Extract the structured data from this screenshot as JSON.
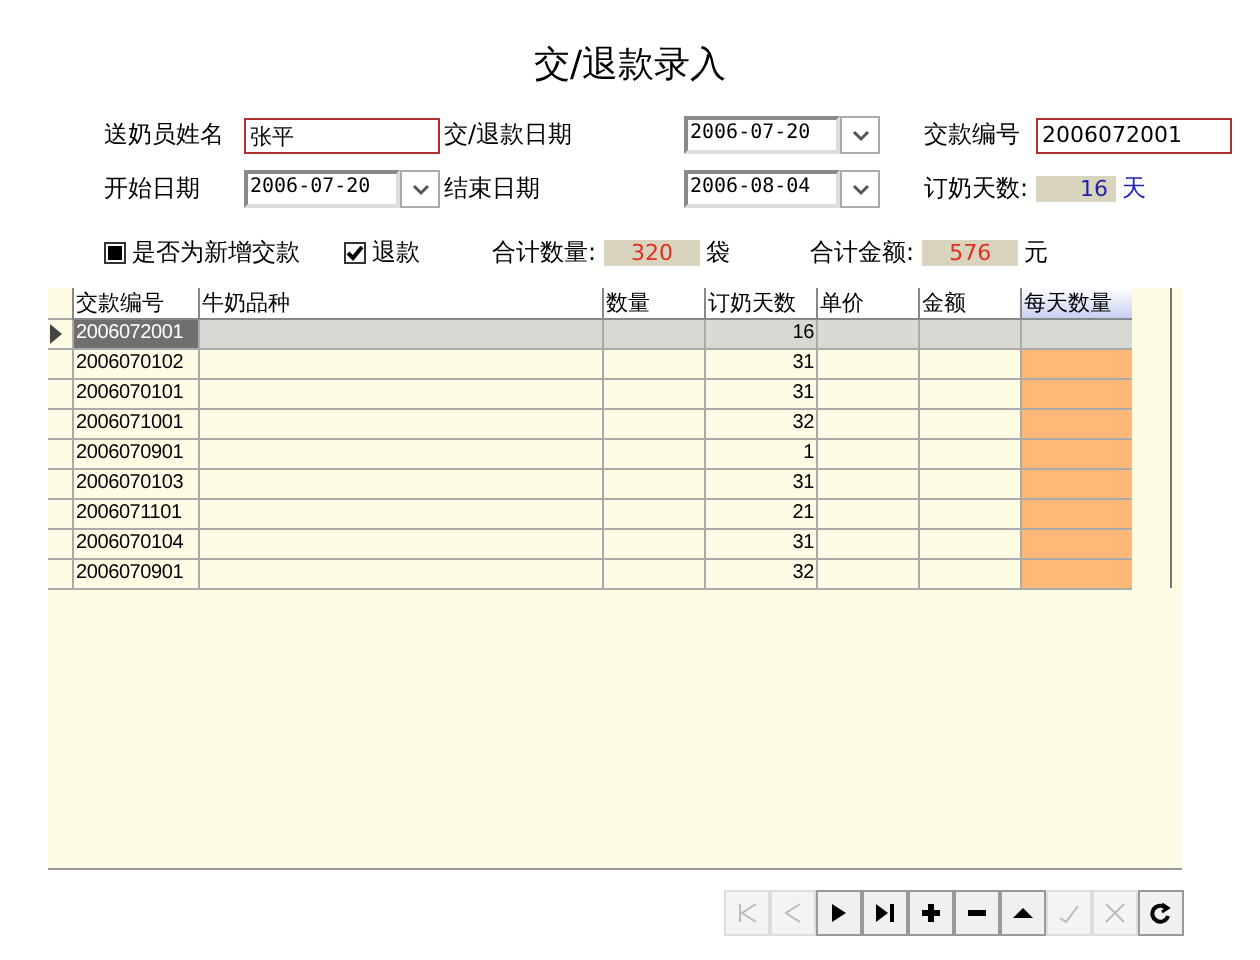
{
  "title": "交/退款录入",
  "fields": [
    {
      "kind": "text",
      "label": "送奶员姓名",
      "value": "张平",
      "required": true
    },
    {
      "kind": "date",
      "label": "交/退款日期",
      "value": "2006-07-20"
    },
    {
      "kind": "text",
      "label": "交款编号",
      "value": "2006072001",
      "required": true
    },
    {
      "kind": "date",
      "label": "开始日期",
      "value": "2006-07-20"
    },
    {
      "kind": "date",
      "label": "结束日期",
      "value": "2006-08-04"
    },
    {
      "kind": "readout",
      "label": "订奶天数:",
      "value": "16",
      "unit": "天"
    }
  ],
  "options": [
    {
      "label": "是否为新增交款",
      "kind": "square",
      "checked": true
    },
    {
      "label": "退款",
      "kind": "tick",
      "checked": true
    }
  ],
  "totals": [
    {
      "label": "合计数量:",
      "value": "320",
      "unit": "袋"
    },
    {
      "label": "合计金额:",
      "value": "576",
      "unit": "元"
    }
  ],
  "table": {
    "columns": [
      "交款编号",
      "牛奶品种",
      "数量",
      "订奶天数",
      "单价",
      "金额",
      "每天数量"
    ],
    "rows": [
      {
        "selected": true,
        "cells": [
          "2006072001",
          "",
          "",
          "16",
          "",
          "",
          ""
        ]
      },
      {
        "selected": false,
        "cells": [
          "2006070102",
          "",
          "",
          "31",
          "",
          "",
          ""
        ]
      },
      {
        "selected": false,
        "cells": [
          "2006070101",
          "",
          "",
          "31",
          "",
          "",
          ""
        ]
      },
      {
        "selected": false,
        "cells": [
          "2006071001",
          "",
          "",
          "32",
          "",
          "",
          ""
        ]
      },
      {
        "selected": false,
        "cells": [
          "2006070901",
          "",
          "",
          "1",
          "",
          "",
          ""
        ]
      },
      {
        "selected": false,
        "cells": [
          "2006070103",
          "",
          "",
          "31",
          "",
          "",
          ""
        ]
      },
      {
        "selected": false,
        "cells": [
          "2006071101",
          "",
          "",
          "21",
          "",
          "",
          ""
        ]
      },
      {
        "selected": false,
        "cells": [
          "2006070104",
          "",
          "",
          "31",
          "",
          "",
          ""
        ]
      },
      {
        "selected": false,
        "cells": [
          "2006070901",
          "",
          "",
          "32",
          "",
          "",
          ""
        ]
      }
    ]
  },
  "navigator": [
    {
      "kind": "first",
      "disabled": true
    },
    {
      "kind": "prior",
      "disabled": true
    },
    {
      "kind": "next",
      "disabled": false
    },
    {
      "kind": "last",
      "disabled": false
    },
    {
      "kind": "insert",
      "disabled": false
    },
    {
      "kind": "delete",
      "disabled": false
    },
    {
      "kind": "edit",
      "disabled": false
    },
    {
      "kind": "post",
      "disabled": true
    },
    {
      "kind": "cancel",
      "disabled": true
    },
    {
      "kind": "refresh",
      "disabled": false
    }
  ]
}
